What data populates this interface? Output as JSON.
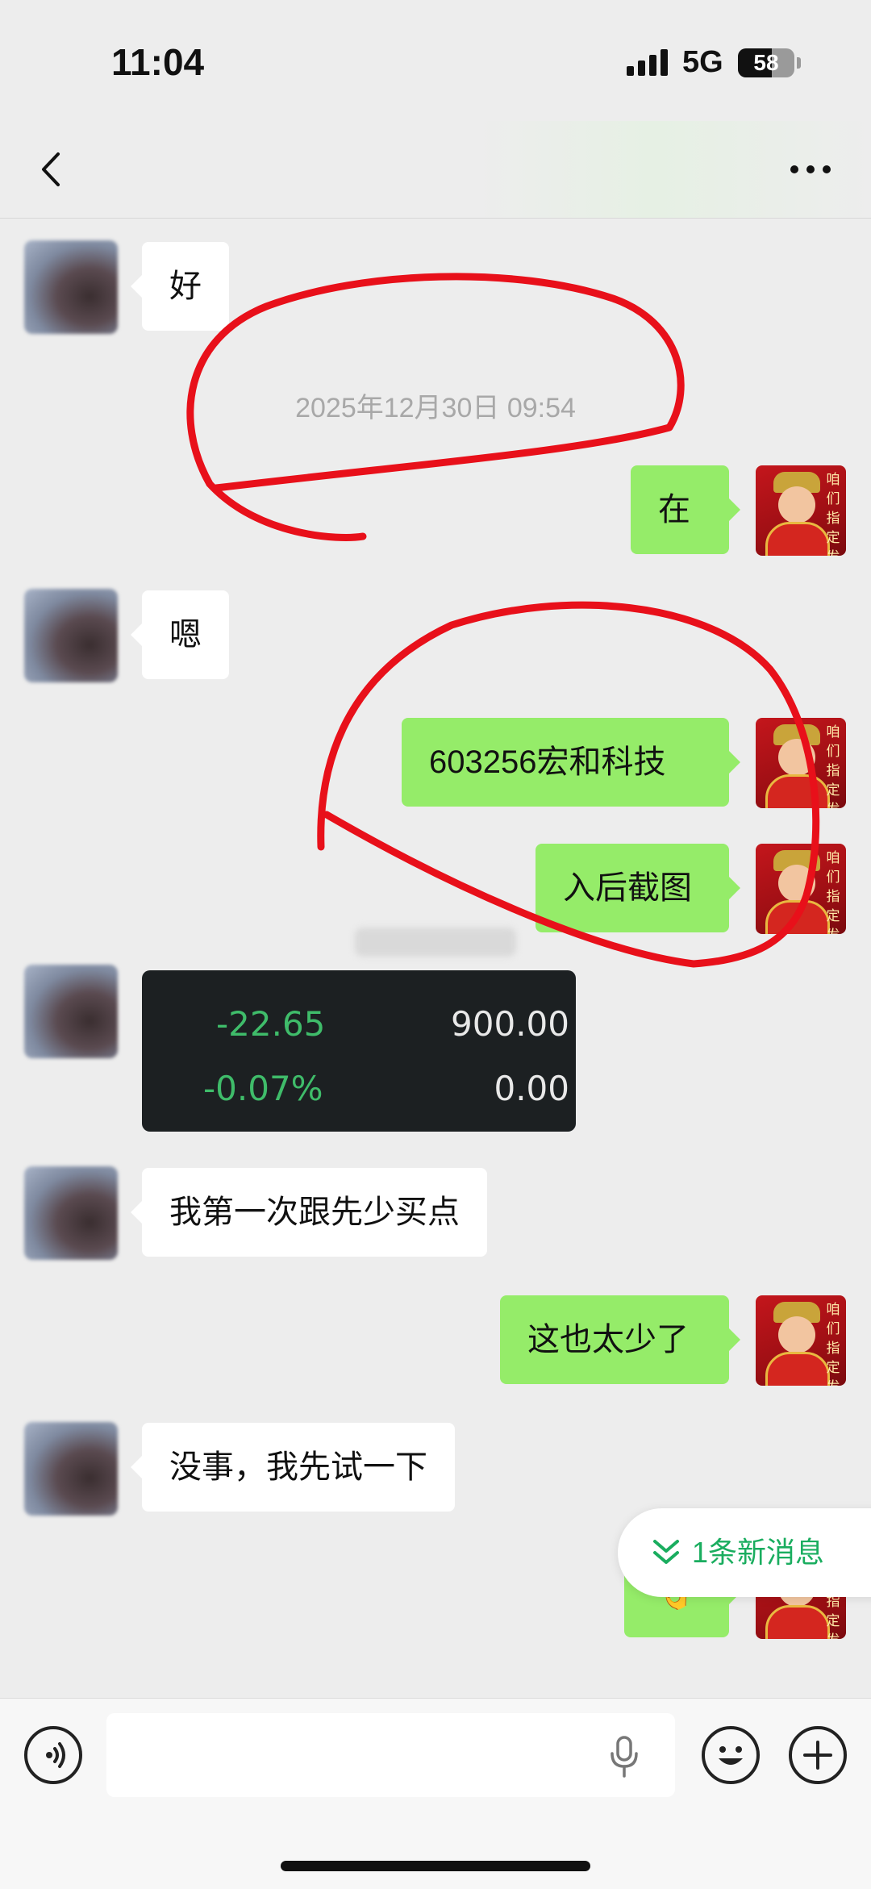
{
  "status_bar": {
    "time": "11:04",
    "network": "5G",
    "battery": "58"
  },
  "nav": {
    "title": ""
  },
  "timestamp": "2025年12月30日 09:54",
  "messages": [
    {
      "side": "in",
      "text": "好"
    },
    {
      "side": "out",
      "text": "在"
    },
    {
      "side": "in",
      "text": "嗯"
    },
    {
      "side": "out",
      "text": "603256宏和科技"
    },
    {
      "side": "out",
      "text": "入后截图"
    },
    {
      "side": "in",
      "text": "我第一次跟先少买点"
    },
    {
      "side": "out",
      "text": "这也太少了"
    },
    {
      "side": "in",
      "text": "没事，我先试一下"
    },
    {
      "side": "out",
      "text": "👌"
    }
  ],
  "stock_card": {
    "change": "-22.65",
    "volume": "900.00",
    "percent": "-0.07%",
    "amount": "0.00"
  },
  "avatar_me_chars": "咱们指定发财",
  "new_message_pill": {
    "label": "1条新消息",
    "icon": "double-chevron-down-icon"
  },
  "input_bar": {
    "voice_icon": "voice-icon",
    "mic_icon": "microphone-icon",
    "emoji_icon": "emoji-icon",
    "plus_icon": "plus-icon"
  },
  "colors": {
    "background": "#ededed",
    "bubble_out": "#95ec69",
    "bubble_in": "#ffffff",
    "accent_green": "#1aad5f",
    "annotation_red": "#e8101a"
  }
}
